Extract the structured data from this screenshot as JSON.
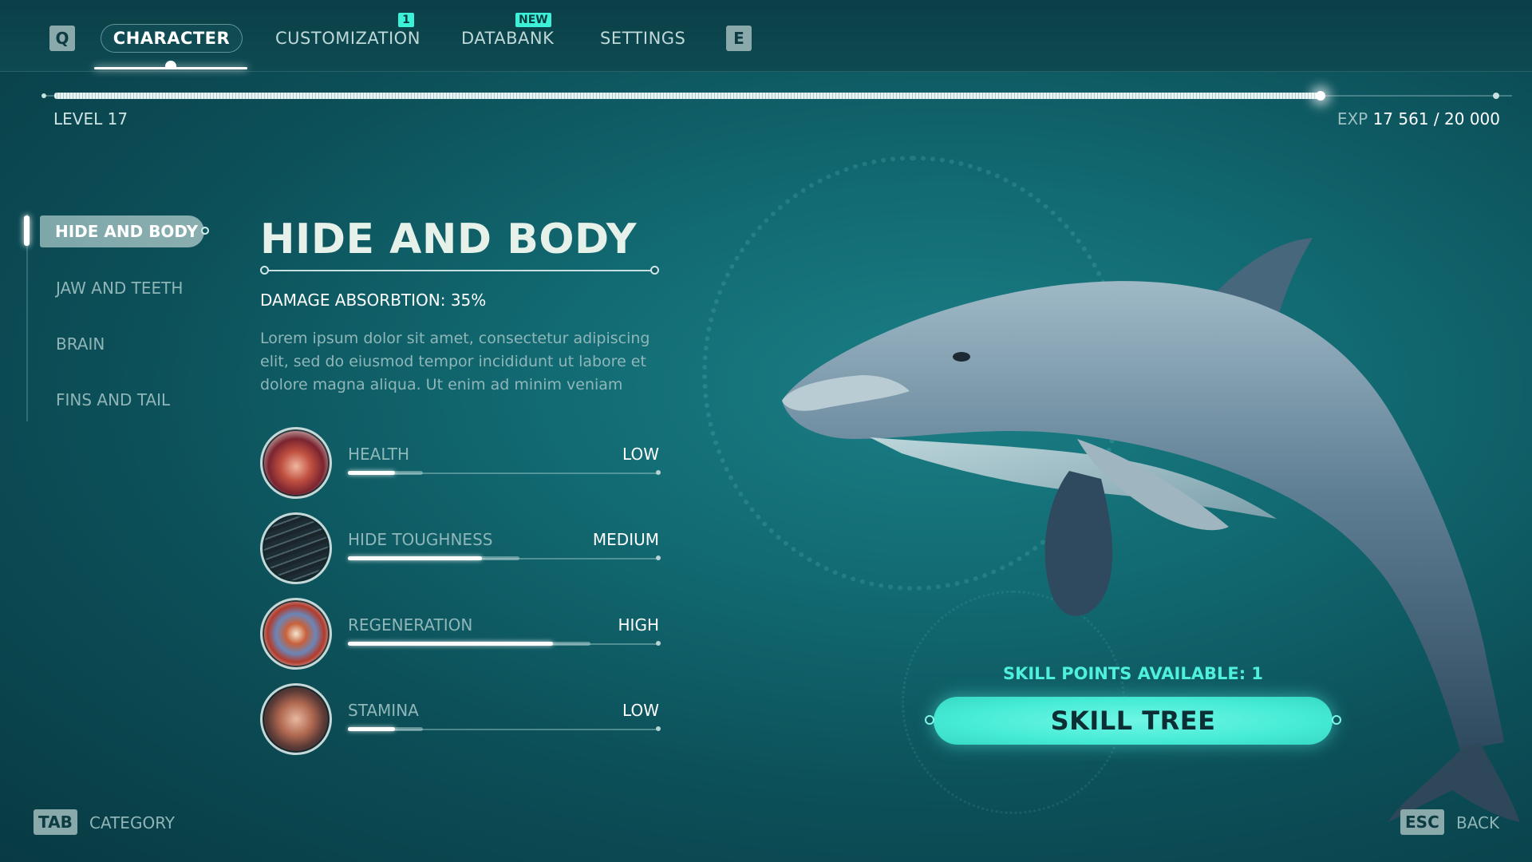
{
  "topbar": {
    "prev_key": "Q",
    "next_key": "E",
    "tabs": [
      {
        "label": "CHARACTER",
        "active": true
      },
      {
        "label": "CUSTOMIZATION",
        "badge": "1"
      },
      {
        "label": "DATABANK",
        "badge": "NEW"
      },
      {
        "label": "SETTINGS"
      }
    ]
  },
  "progress": {
    "level_label": "LEVEL 17",
    "exp_prefix": "EXP",
    "exp_value": "17 561 / 20 000",
    "fill_fraction": 0.878
  },
  "sidebar": {
    "items": [
      {
        "label": "HIDE AND BODY",
        "active": true
      },
      {
        "label": "JAW AND TEETH"
      },
      {
        "label": "BRAIN"
      },
      {
        "label": "FINS AND TAIL"
      }
    ]
  },
  "detail": {
    "title": "HIDE AND BODY",
    "damage": "DAMAGE ABSORBTION: 35%",
    "description": "Lorem ipsum dolor sit amet, consectetur adipiscing elit, sed do eiusmod tempor incididunt ut labore et dolore magna aliqua. Ut enim ad minim veniam",
    "stats": [
      {
        "label": "HEALTH",
        "value": "LOW",
        "icon": "heart-icon",
        "level": 0.15,
        "potential": 0.24
      },
      {
        "label": "HIDE TOUGHNESS",
        "value": "MEDIUM",
        "icon": "hide-texture-icon",
        "level": 0.43,
        "potential": 0.55
      },
      {
        "label": "REGENERATION",
        "value": "HIGH",
        "icon": "regeneration-icon",
        "level": 0.66,
        "potential": 0.78
      },
      {
        "label": "STAMINA",
        "value": "LOW",
        "icon": "lungs-icon",
        "level": 0.15,
        "potential": 0.24
      }
    ]
  },
  "skills": {
    "points_label": "SKILL POINTS AVAILABLE: 1",
    "button_label": "SKILL TREE"
  },
  "footer": {
    "left_key": "TAB",
    "left_label": "CATEGORY",
    "right_key": "ESC",
    "right_label": "BACK"
  },
  "colors": {
    "accent": "#47ecd6",
    "background": "#0f5f68",
    "text_highlight": "#ffffff"
  }
}
